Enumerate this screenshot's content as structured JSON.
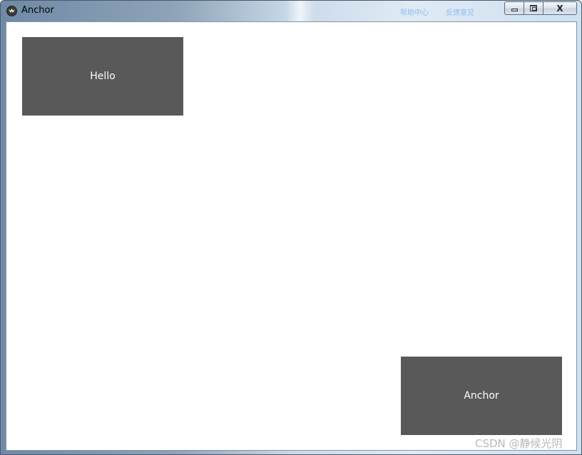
{
  "window": {
    "title": "Anchor",
    "background_links": [
      "帮助中心",
      "反馈意见"
    ],
    "caption": {
      "minimize": "",
      "maximize": "",
      "close": "X"
    }
  },
  "main": {
    "buttons": [
      {
        "label": "Hello"
      },
      {
        "label": "Anchor"
      }
    ]
  },
  "watermark": "CSDN @静候光阴",
  "colors": {
    "button_bg": "#595959",
    "button_text": "#ffffff",
    "client_bg": "#ffffff"
  },
  "icons": {
    "app": "kivy-logo-icon",
    "minimize": "minimize-icon",
    "maximize": "maximize-icon",
    "close": "close-icon"
  }
}
